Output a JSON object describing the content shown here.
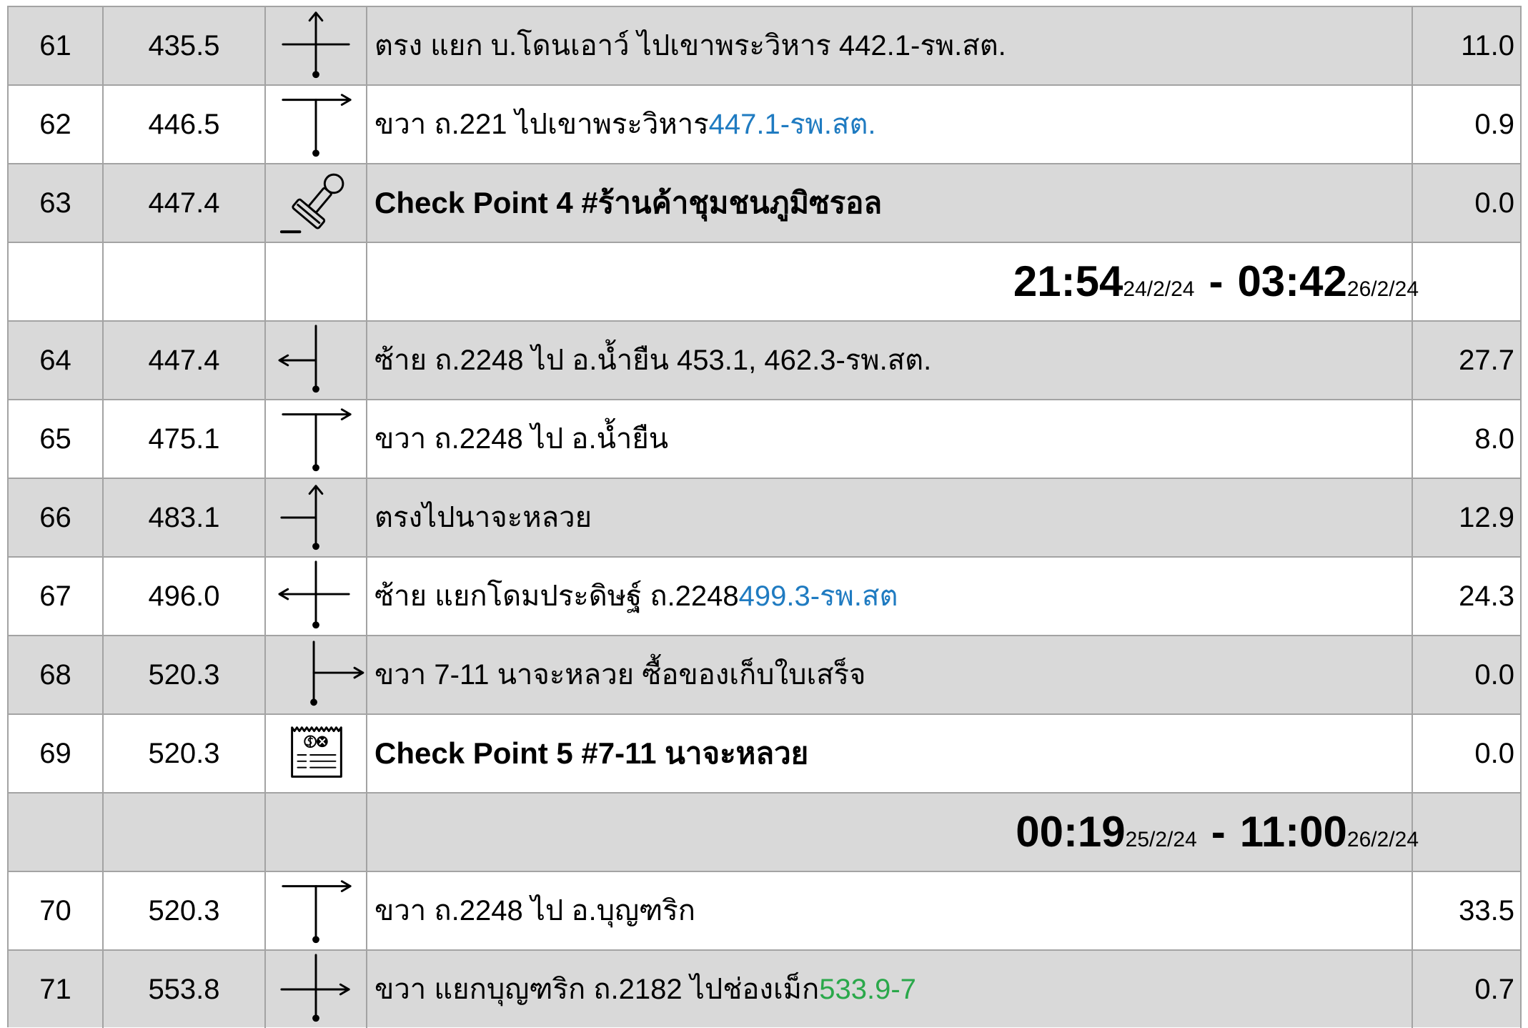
{
  "colors": {
    "row_gray": "#d9d9d9",
    "row_white": "#ffffff",
    "border": "#a3a3a3",
    "highlight_blue": "#1f7bc1",
    "highlight_green": "#2aa84a",
    "text": "#000000"
  },
  "rows": [
    {
      "type": "step",
      "no": "61",
      "km": "435.5",
      "icon": "straight-through-intersection-icon",
      "text": "ตรง แยก บ.โดนเอาว์ ไปเขาพระวิหาร 442.1-รพ.สต.",
      "dist": "11.0"
    },
    {
      "type": "step",
      "no": "62",
      "km": "446.5",
      "icon": "turn-right-t-junction-icon",
      "text": "ขวา ถ.221 ไปเขาพระวิหาร ",
      "text_highlight": "447.1-รพ.สต.",
      "dist": "0.9"
    },
    {
      "type": "checkpoint",
      "no": "63",
      "km": "447.4",
      "icon": "stamp-icon",
      "text": "Check Point 4 #ร้านค้าชุมชนภูมิซรอล",
      "dist": "0.0"
    },
    {
      "type": "time",
      "start_time": "21:54",
      "start_date": "24/2/24",
      "separator": "-",
      "end_time": "03:42",
      "end_date": "26/2/24"
    },
    {
      "type": "step",
      "no": "64",
      "km": "447.4",
      "icon": "turn-left-icon",
      "text": "ซ้าย ถ.2248 ไป อ.น้ำยืน 453.1, 462.3-รพ.สต.",
      "dist": "27.7"
    },
    {
      "type": "step",
      "no": "65",
      "km": "475.1",
      "icon": "turn-right-t-junction-icon",
      "text": "ขวา ถ.2248 ไป อ.น้ำยืน",
      "dist": "8.0"
    },
    {
      "type": "step",
      "no": "66",
      "km": "483.1",
      "icon": "straight-ahead-icon",
      "text": "ตรงไปนาจะหลวย",
      "dist": "12.9"
    },
    {
      "type": "step",
      "no": "67",
      "km": "496.0",
      "icon": "turn-left-intersection-icon",
      "text": "ซ้าย แยกโดมประดิษฐ์ ถ.2248 ",
      "text_highlight": "499.3-รพ.สต",
      "dist": "24.3"
    },
    {
      "type": "step",
      "no": "68",
      "km": "520.3",
      "icon": "turn-right-icon",
      "text": "ขวา 7-11 นาจะหลวย ซื้อของเก็บใบเสร็จ",
      "dist": "0.0"
    },
    {
      "type": "checkpoint",
      "no": "69",
      "km": "520.3",
      "icon": "receipt-icon",
      "text": "Check Point 5 #7-11 นาจะหลวย",
      "dist": "0.0"
    },
    {
      "type": "time",
      "start_time": "00:19",
      "start_date": "25/2/24",
      "separator": "-",
      "end_time": "11:00",
      "end_date": "26/2/24"
    },
    {
      "type": "step",
      "no": "70",
      "km": "520.3",
      "icon": "turn-right-t-junction-icon",
      "text": "ขวา ถ.2248 ไป อ.บุญฑริก",
      "dist": "33.5"
    },
    {
      "type": "step",
      "no": "71",
      "km": "553.8",
      "icon": "turn-right-intersection-icon",
      "text": "ขวา แยกบุญฑริก ถ.2182 ไปช่องเม็ก ",
      "text_highlight": "533.9-7",
      "dist": "0.7"
    }
  ]
}
